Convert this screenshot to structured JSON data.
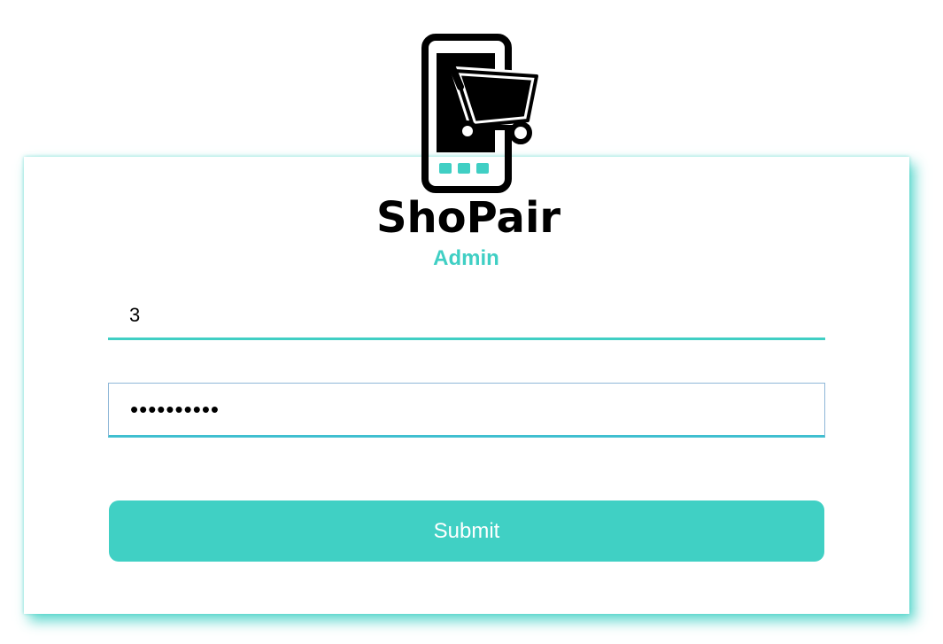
{
  "brand": {
    "name": "ShoPair",
    "subtitle": "Admin",
    "accent_color": "#40d0c4",
    "logo_icon": "phone-cart-icon"
  },
  "form": {
    "username_value": "3",
    "password_value": "••••••••••",
    "submit_label": "Submit"
  }
}
